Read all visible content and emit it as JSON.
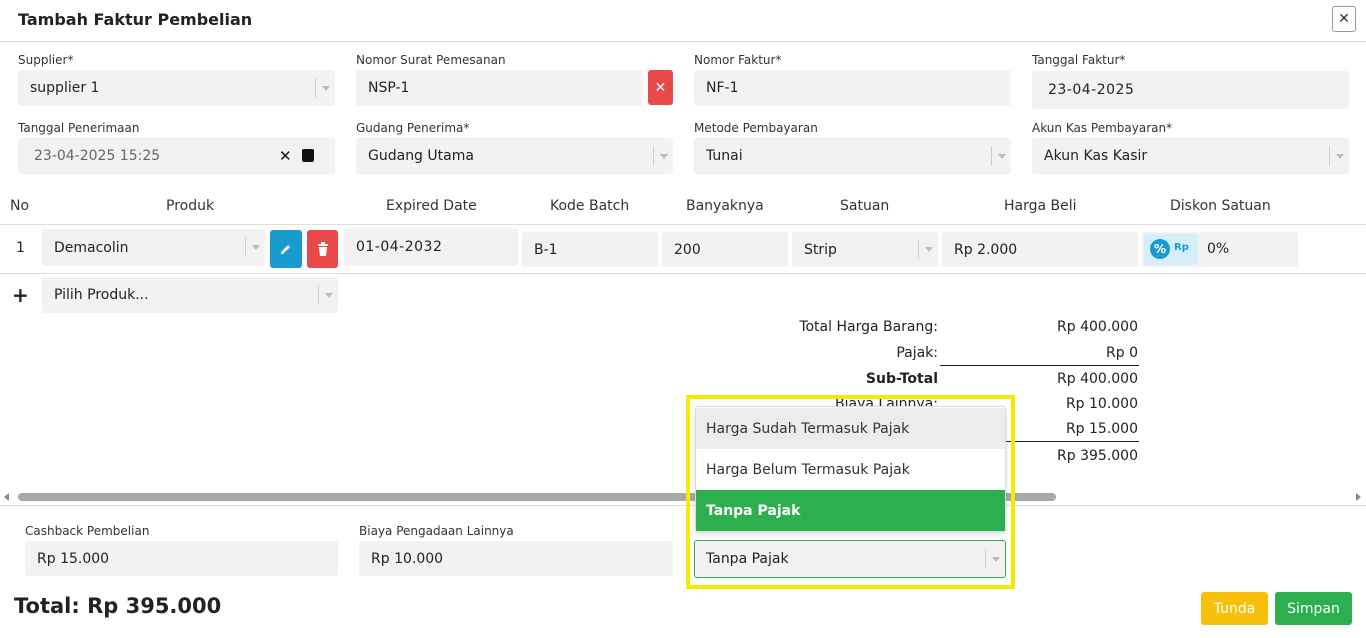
{
  "modal": {
    "title": "Tambah Faktur Pembelian",
    "close_icon": "close-icon"
  },
  "header_fields": {
    "supplier": {
      "label": "Supplier*",
      "value": "supplier 1"
    },
    "nomor_surat_pemesanan": {
      "label": "Nomor Surat Pemesanan",
      "value": "NSP-1"
    },
    "nomor_faktur": {
      "label": "Nomor Faktur*",
      "value": "NF-1"
    },
    "tanggal_faktur": {
      "label": "Tanggal Faktur*",
      "value": "23-04-2025"
    },
    "tanggal_penerimaan": {
      "label": "Tanggal Penerimaan",
      "value": "23-04-2025 15:25"
    },
    "gudang_penerima": {
      "label": "Gudang Penerima*",
      "value": "Gudang Utama"
    },
    "metode_pembayaran": {
      "label": "Metode Pembayaran",
      "value": "Tunai"
    },
    "akun_kas_pembayaran": {
      "label": "Akun Kas Pembayaran*",
      "value": "Akun Kas Kasir"
    }
  },
  "table": {
    "headers": [
      "No",
      "Produk",
      "Expired Date",
      "Kode Batch",
      "Banyaknya",
      "Satuan",
      "Harga Beli",
      "Diskon Satuan"
    ],
    "rows": [
      {
        "no": "1",
        "produk": "Demacolin",
        "expired_date": "01-04-2032",
        "kode_batch": "B-1",
        "banyaknya": "200",
        "satuan": "Strip",
        "harga_beli": "Rp 2.000",
        "diskon_mode": "Rp",
        "diskon_satuan": "0%"
      }
    ],
    "add_row": {
      "icon": "+",
      "placeholder": "Pilih Produk..."
    }
  },
  "summary": {
    "total_harga_barang": {
      "label": "Total Harga Barang:",
      "value": "Rp 400.000"
    },
    "pajak": {
      "label": "Pajak:",
      "value": "Rp 0"
    },
    "sub_total": {
      "label": "Sub-Total",
      "value": "Rp 400.000"
    },
    "biaya_lainnya": {
      "label": "Biaya Lainnya:",
      "value": "Rp 10.000"
    },
    "cashback": {
      "value": "Rp 15.000"
    },
    "grand_total": {
      "value": "Rp 395.000"
    }
  },
  "bottom_fields": {
    "cashback_pembelian": {
      "label": "Cashback Pembelian",
      "value": "Rp 15.000"
    },
    "biaya_pengadaan_lainnya": {
      "label": "Biaya Pengadaan Lainnya",
      "value": "Rp 10.000"
    },
    "pajak_select": {
      "value": "Tanpa Pajak"
    }
  },
  "pajak_dropdown": {
    "options": [
      "Harga Sudah Termasuk Pajak",
      "Harga Belum Termasuk Pajak",
      "Tanpa Pajak"
    ],
    "hovered_index": 0,
    "selected_index": 2
  },
  "footer": {
    "total_text": "Total: Rp 395.000",
    "tunda_label": "Tunda",
    "simpan_label": "Simpan"
  },
  "colors": {
    "selected_green": "#2eaf4f",
    "danger_red": "#e84a4a",
    "primary_blue": "#1a9bd0",
    "warning_yellow": "#f7c10b",
    "highlight_yellow": "#f7ea00"
  }
}
